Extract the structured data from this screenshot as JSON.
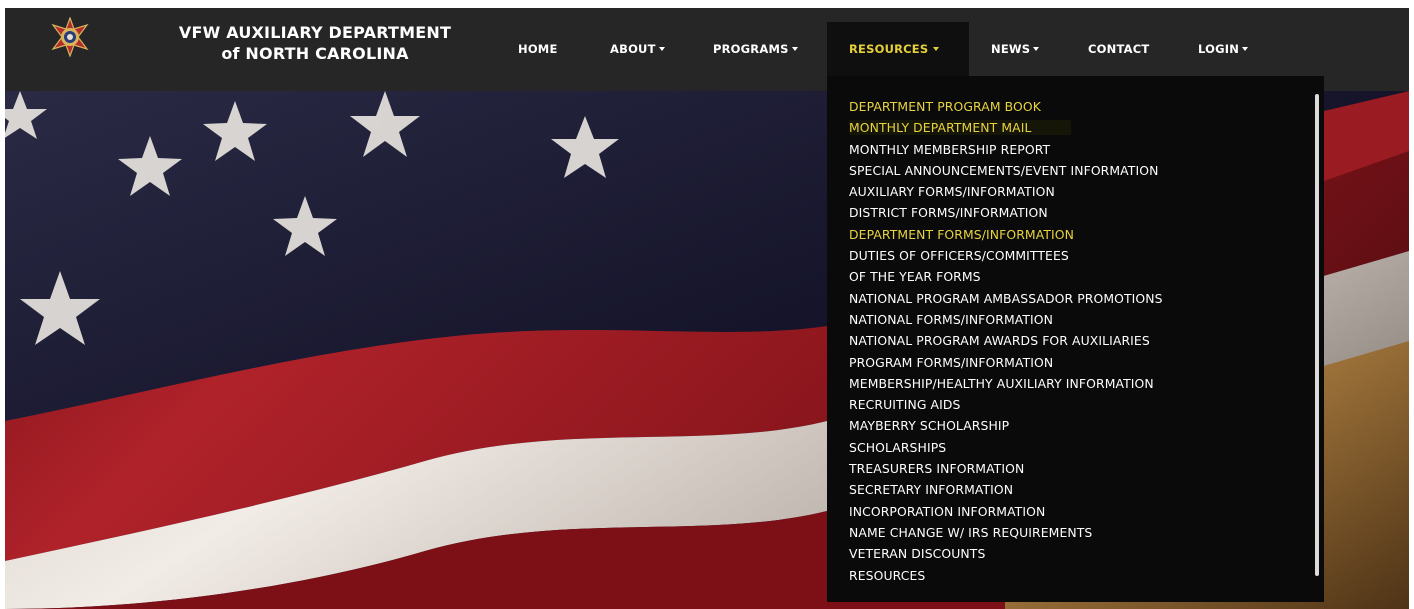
{
  "brand": {
    "line1": "VFW AUXILIARY DEPARTMENT",
    "line2": "of NORTH CAROLINA"
  },
  "nav": {
    "home": "HOME",
    "about": "ABOUT",
    "programs": "PROGRAMS",
    "resources": "RESOURCES",
    "news": "NEWS",
    "contact": "CONTACT",
    "login": "LOGIN"
  },
  "dropdown": {
    "items": [
      "DEPARTMENT PROGRAM BOOK",
      "MONTHLY DEPARTMENT MAIL",
      "MONTHLY MEMBERSHIP REPORT",
      "SPECIAL ANNOUNCEMENTS/EVENT INFORMATION",
      "AUXILIARY FORMS/INFORMATION",
      "DISTRICT FORMS/INFORMATION",
      "DEPARTMENT FORMS/INFORMATION",
      "DUTIES OF OFFICERS/COMMITTEES",
      "OF THE YEAR FORMS",
      "NATIONAL PROGRAM AMBASSADOR PROMOTIONS",
      "NATIONAL FORMS/INFORMATION",
      "NATIONAL PROGRAM AWARDS FOR AUXILIARIES",
      "PROGRAM FORMS/INFORMATION",
      "MEMBERSHIP/HEALTHY AUXILIARY INFORMATION",
      "RECRUITING AIDS",
      "MAYBERRY SCHOLARSHIP",
      "SCHOLARSHIPS",
      "TREASURERS INFORMATION",
      "SECRETARY INFORMATION",
      "INCORPORATION INFORMATION",
      "NAME CHANGE W/ IRS REQUIREMENTS",
      "VETERAN DISCOUNTS",
      "RESOURCES"
    ]
  },
  "colors": {
    "navbar": "#262626",
    "dropdown": "#0a0a0a",
    "accent_yellow": "#e8d43e",
    "flag_red": "#9e1b22",
    "flag_blue": "#1b1a2c"
  },
  "icons": {
    "logo": "vfw-auxiliary-emblem-icon",
    "caret": "caret-down-icon"
  }
}
